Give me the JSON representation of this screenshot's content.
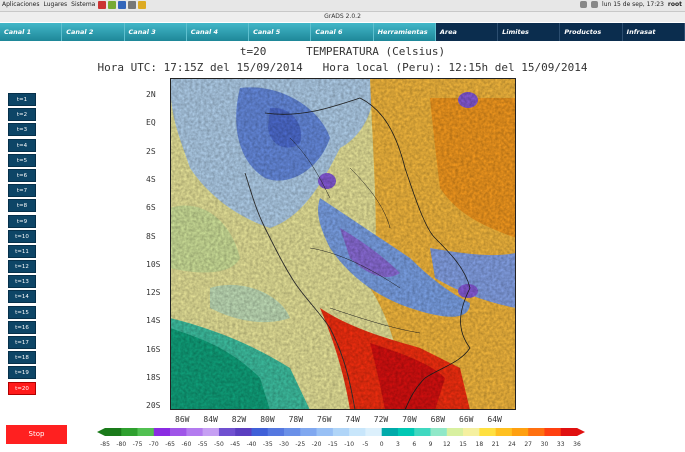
{
  "sysbar": {
    "menu": [
      "Aplicaciones",
      "Lugares",
      "Sistema"
    ],
    "clock": "lun 15 de sep, 17:23",
    "user": "root"
  },
  "window_title": "GrADS 2.0.2",
  "tabs": [
    "Canal 1",
    "Canal 2",
    "Canal 3",
    "Canal 4",
    "Canal 5",
    "Canal 6",
    "Herramientas",
    "Area",
    "Limites",
    "Productos",
    "Infrasat"
  ],
  "header": {
    "line1": "t=20      TEMPERATURA (Celsius)",
    "line2": "Hora UTC: 17:15Z del 15/09/2014   Hora local (Peru): 12:15h del 15/09/2014"
  },
  "time_buttons": [
    "t=1",
    "t=2",
    "t=3",
    "t=4",
    "t=5",
    "t=6",
    "t=7",
    "t=8",
    "t=9",
    "t=10",
    "t=11",
    "t=12",
    "t=13",
    "t=14",
    "t=15",
    "t=16",
    "t=17",
    "t=18",
    "t=19",
    "t=20"
  ],
  "active_time": "t=20",
  "stop_label": "Stop",
  "map": {
    "lat_labels": [
      "2N",
      "EQ",
      "2S",
      "4S",
      "6S",
      "8S",
      "10S",
      "12S",
      "14S",
      "16S",
      "18S",
      "20S"
    ],
    "lon_labels": [
      "86W",
      "84W",
      "82W",
      "80W",
      "78W",
      "76W",
      "74W",
      "72W",
      "70W",
      "68W",
      "66W",
      "64W"
    ]
  },
  "colorbar": {
    "labels": [
      "-85",
      "-80",
      "-75",
      "-70",
      "-65",
      "-60",
      "-55",
      "-50",
      "-45",
      "-40",
      "-35",
      "-30",
      "-25",
      "-20",
      "-15",
      "-10",
      "-5",
      "0",
      "3",
      "6",
      "9",
      "12",
      "15",
      "18",
      "21",
      "24",
      "27",
      "30",
      "33",
      "36"
    ],
    "colors": [
      "#1a7a1a",
      "#2fa02f",
      "#52c052",
      "#8a2be2",
      "#9f55e8",
      "#b37bef",
      "#c69ff3",
      "#7050d0",
      "#5a3ec0",
      "#4060d8",
      "#5578e0",
      "#6a90e8",
      "#80a8f0",
      "#98c0f5",
      "#b0d5f8",
      "#c8e6fb",
      "#dcf0fc",
      "#00aaaa",
      "#00c8b4",
      "#40d8c0",
      "#90e8c8",
      "#d8f0a0",
      "#f5f0a0",
      "#ffe040",
      "#ffc020",
      "#ffa010",
      "#ff7010",
      "#ff4010",
      "#e01010"
    ]
  }
}
